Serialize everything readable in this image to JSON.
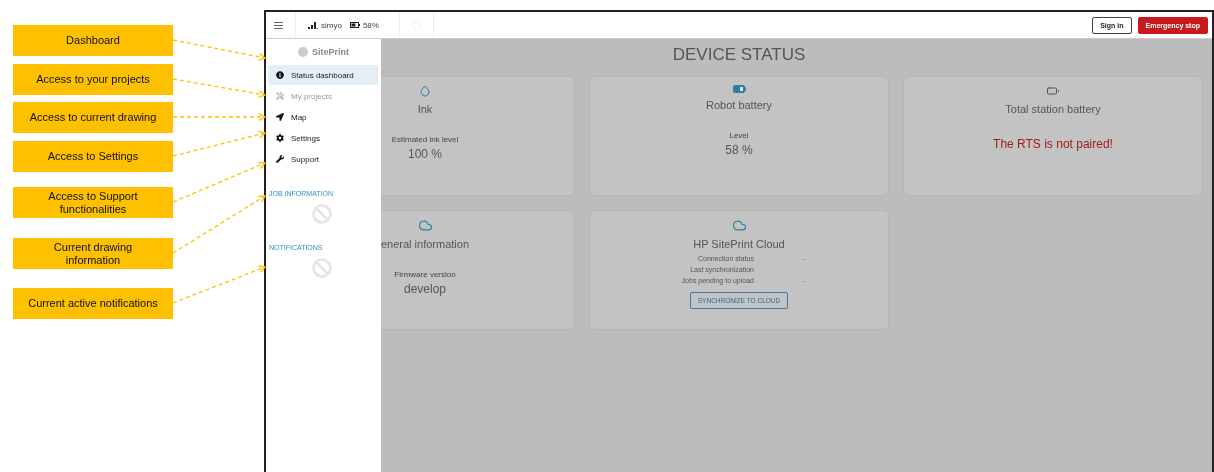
{
  "callouts": [
    {
      "text": "Dashboard"
    },
    {
      "text": "Access to your projects"
    },
    {
      "text": "Access to current drawing"
    },
    {
      "text": "Access to Settings"
    },
    {
      "text": "Access to Support functionalities"
    },
    {
      "text": "Current drawing information"
    },
    {
      "text": "Current active notifications"
    }
  ],
  "top_bar": {
    "carrier": "simyo",
    "battery": "58%",
    "buttons": [
      {
        "label": "Sign in",
        "kind": "outline"
      },
      {
        "label": "Emergency stop",
        "kind": "danger"
      }
    ]
  },
  "sidebar": {
    "logo": "SitePrint",
    "items": [
      {
        "label": "Status dashboard",
        "selected": true,
        "disabled": false
      },
      {
        "label": "My projects",
        "selected": false,
        "disabled": true
      },
      {
        "label": "Map",
        "selected": false,
        "disabled": false
      },
      {
        "label": "Settings",
        "selected": false,
        "disabled": false
      },
      {
        "label": "Support",
        "selected": false,
        "disabled": false
      }
    ],
    "sections": [
      {
        "title": "JOB INFORMATION"
      },
      {
        "title": "NOTIFICATIONS"
      }
    ]
  },
  "main": {
    "title": "DEVICE STATUS",
    "cards": [
      {
        "kind": "metric",
        "title": "Ink",
        "caption": "Estimated ink level",
        "value": "100 %"
      },
      {
        "kind": "metric",
        "title": "Robot battery",
        "caption": "Level",
        "value": "58 %"
      },
      {
        "kind": "message",
        "title": "Total station battery",
        "message": "The RTS is not paired!"
      },
      {
        "kind": "metric",
        "title": "eneral information",
        "caption": "Firmware version",
        "value": "develop"
      },
      {
        "kind": "rows",
        "title": "HP SitePrint Cloud",
        "rows": [
          {
            "label": "Connection status",
            "value": "-"
          },
          {
            "label": "Last synchronization"
          },
          {
            "label": "Jobs pending to upload",
            "value": "-"
          }
        ],
        "button": "SYNCHRONIZE TO CLOUD"
      }
    ]
  }
}
